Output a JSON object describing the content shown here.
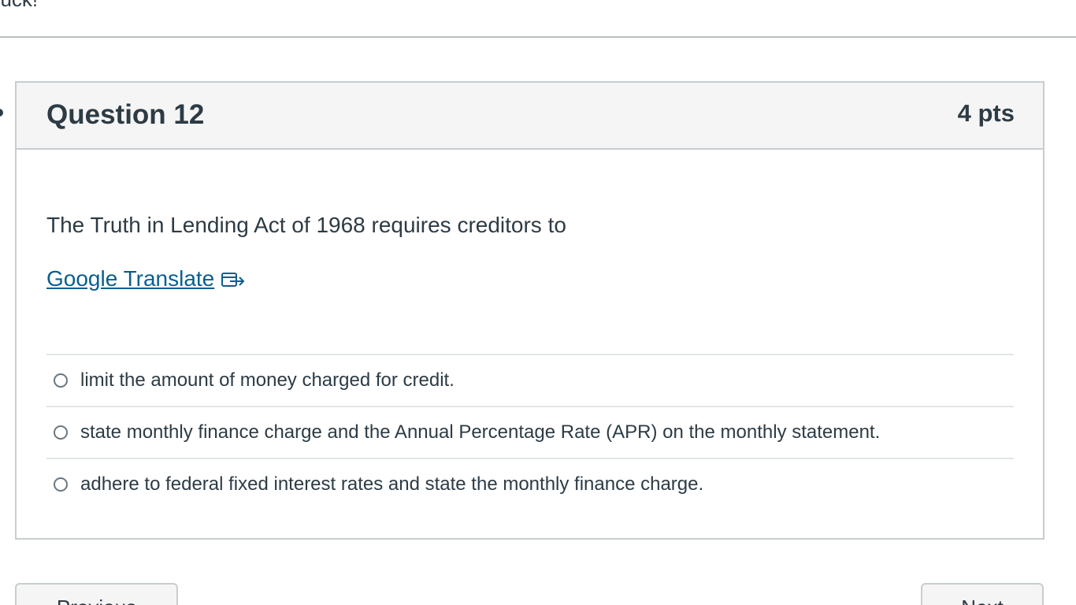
{
  "header": {
    "partial_text": "Luck!"
  },
  "question": {
    "title": "Question 12",
    "points": "4 pts",
    "text": "The Truth in Lending Act of 1968 requires creditors to",
    "translate_link": "Google Translate",
    "translate_icon": "external-link-icon",
    "answers": [
      {
        "label": "limit the amount of money charged for credit."
      },
      {
        "label": "state monthly finance charge and the Annual Percentage Rate (APR) on the monthly statement."
      },
      {
        "label": "adhere to federal fixed interest rates and state the monthly finance charge."
      }
    ]
  },
  "navigation": {
    "previous_label": "Previous",
    "next_label": "Next"
  },
  "colors": {
    "link": "#0b5e8f",
    "text": "#2d3b45",
    "header_bg": "#f5f5f5",
    "border": "#c7cdd1"
  }
}
